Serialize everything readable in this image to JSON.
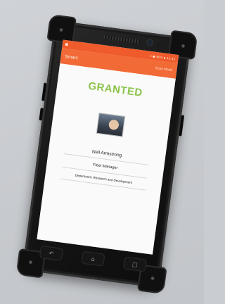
{
  "status_bar": {
    "text": "▾ ● 96% ▮ 12:45"
  },
  "app_bar": {
    "title": "Smart",
    "action": "Scan Mode"
  },
  "access": {
    "result": "GRANTED",
    "result_color": "#8bc34a"
  },
  "person": {
    "name": "Neil Armstrong",
    "title": "Fleet Manager",
    "department": "Department: Research and Development"
  },
  "nav_keys": {
    "back": "↶",
    "home": "⌂",
    "recent": "□"
  },
  "colors": {
    "app_bar": "#f26a35",
    "status_bar": "#ef5b2b",
    "phone_body": "#141414"
  }
}
